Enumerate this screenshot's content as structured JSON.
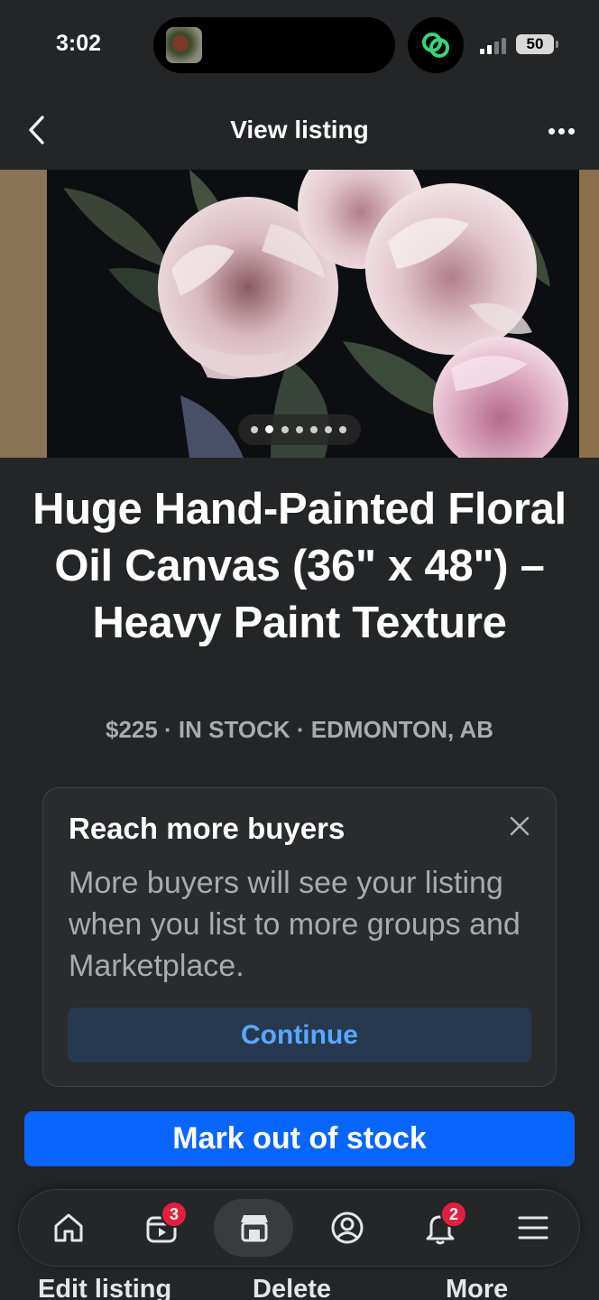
{
  "status_bar": {
    "time": "3:02",
    "battery": "50"
  },
  "header": {
    "title": "View listing"
  },
  "photo": {
    "page_count": 7,
    "current_page": 2
  },
  "listing": {
    "title": "Huge Hand-Painted Floral Oil Canvas (36\" x 48\") – Heavy Paint Texture",
    "meta": "$225 · IN STOCK · EDMONTON, AB"
  },
  "reach_card": {
    "title": "Reach more buyers",
    "body": "More buyers will see your listing when you list to more groups and Marketplace.",
    "button": "Continue"
  },
  "primary_action": {
    "label": "Mark out of stock"
  },
  "secondary_actions": {
    "edit": "Edit listing",
    "delete": "Delete",
    "more": "More"
  },
  "tab_bar": {
    "tabs": [
      {
        "name": "home",
        "icon": "home-icon",
        "badge": ""
      },
      {
        "name": "video",
        "icon": "video-icon",
        "badge": "3"
      },
      {
        "name": "marketplace",
        "icon": "marketplace-icon",
        "badge": "",
        "active": true
      },
      {
        "name": "profile",
        "icon": "profile-icon",
        "badge": ""
      },
      {
        "name": "notifications",
        "icon": "bell-icon",
        "badge": "2"
      },
      {
        "name": "menu",
        "icon": "menu-icon",
        "badge": ""
      }
    ]
  },
  "colors": {
    "background": "#242527",
    "accent": "#0866ff",
    "badge": "#e41e3f",
    "link": "#5aa7ff"
  }
}
